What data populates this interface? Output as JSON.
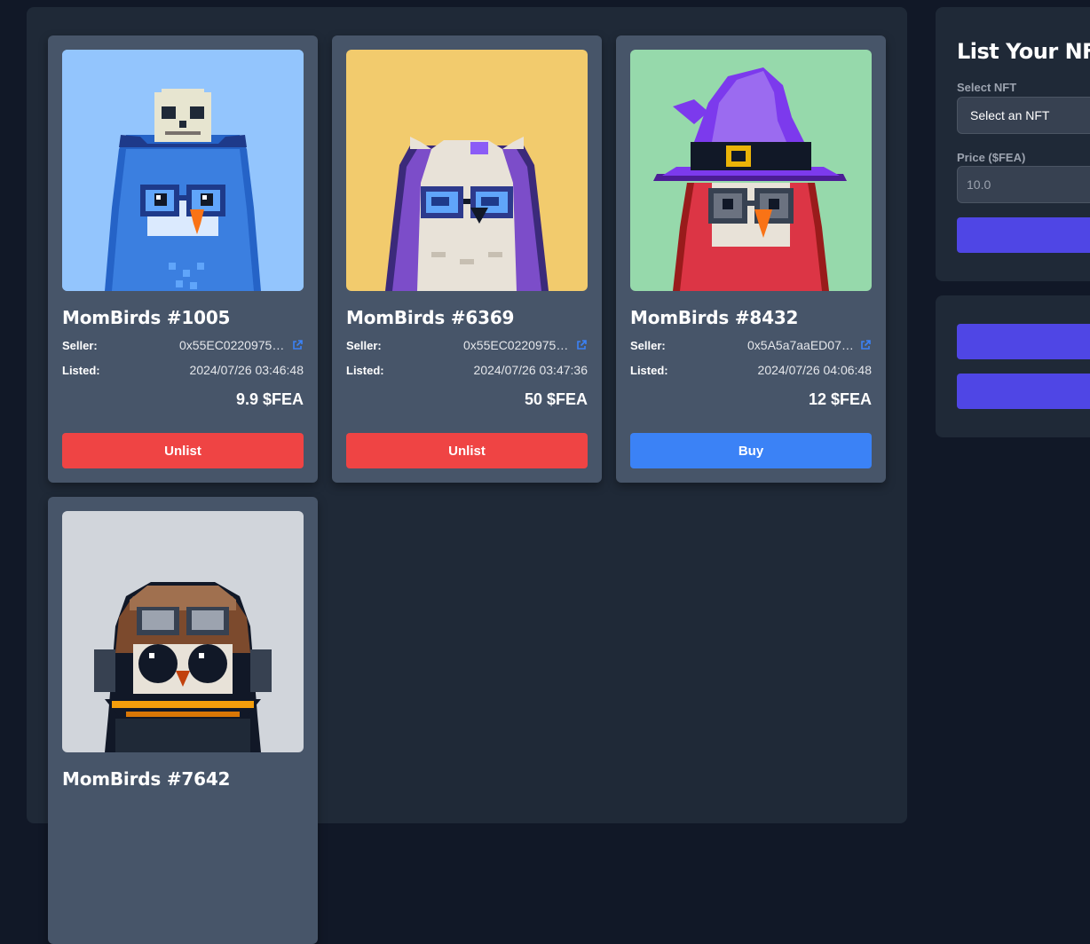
{
  "listings": [
    {
      "name": "MomBirds #1005",
      "seller_label": "Seller:",
      "seller": "0x55EC0220975fF...",
      "listed_label": "Listed:",
      "listed": "2024/07/26 03:46:48",
      "price": "9.9 $FEA",
      "action": "Unlist",
      "bg": "#93c5fd"
    },
    {
      "name": "MomBirds #6369",
      "seller_label": "Seller:",
      "seller": "0x55EC0220975fF...",
      "listed_label": "Listed:",
      "listed": "2024/07/26 03:47:36",
      "price": "50 $FEA",
      "action": "Unlist",
      "bg": "#f2cb6d"
    },
    {
      "name": "MomBirds #8432",
      "seller_label": "Seller:",
      "seller": "0x5A5a7aaED072...",
      "listed_label": "Listed:",
      "listed": "2024/07/26 04:06:48",
      "price": "12 $FEA",
      "action": "Buy",
      "bg": "#96d9ab"
    },
    {
      "name": "MomBirds #7642",
      "bg": "#d1d5db"
    }
  ],
  "list_form": {
    "title": "List Your NFT",
    "select_label": "Select NFT",
    "select_value": "Select an NFT",
    "price_label": "Price ($FEA)",
    "price_placeholder": "10.0"
  },
  "icons": {
    "seller_link": "external-link-icon"
  },
  "colors": {
    "unlist": "#ef4444",
    "buy": "#3b82f6",
    "primary": "#4f46e5",
    "card_bg": "#475569",
    "panel_bg": "#1f2937",
    "page_bg": "#111827"
  }
}
